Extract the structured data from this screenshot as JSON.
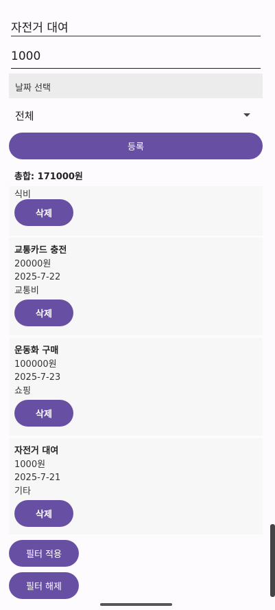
{
  "form": {
    "title_value": "자전거 대여",
    "amount_value": "1000",
    "date_button_label": "날짜 선택",
    "category_selected": "전체",
    "register_label": "등록"
  },
  "summary": {
    "total_label": "총합: 171000원"
  },
  "expenses": [
    {
      "name": "",
      "amount": "",
      "date": "",
      "category": "식비",
      "delete_label": "삭제"
    },
    {
      "name": "교통카드 충전",
      "amount": "20000원",
      "date": "2025-7-22",
      "category": "교통비",
      "delete_label": "삭제"
    },
    {
      "name": "운동화 구매",
      "amount": "100000원",
      "date": "2025-7-23",
      "category": "쇼핑",
      "delete_label": "삭제"
    },
    {
      "name": "자전거 대여",
      "amount": "1000원",
      "date": "2025-7-21",
      "category": "기타",
      "delete_label": "삭제"
    }
  ],
  "filters": {
    "apply_label": "필터 적용",
    "clear_label": "필터 해제"
  },
  "colors": {
    "primary": "#6750a4",
    "card_bg": "#f7f7f7",
    "page_bg": "#fefbff"
  }
}
